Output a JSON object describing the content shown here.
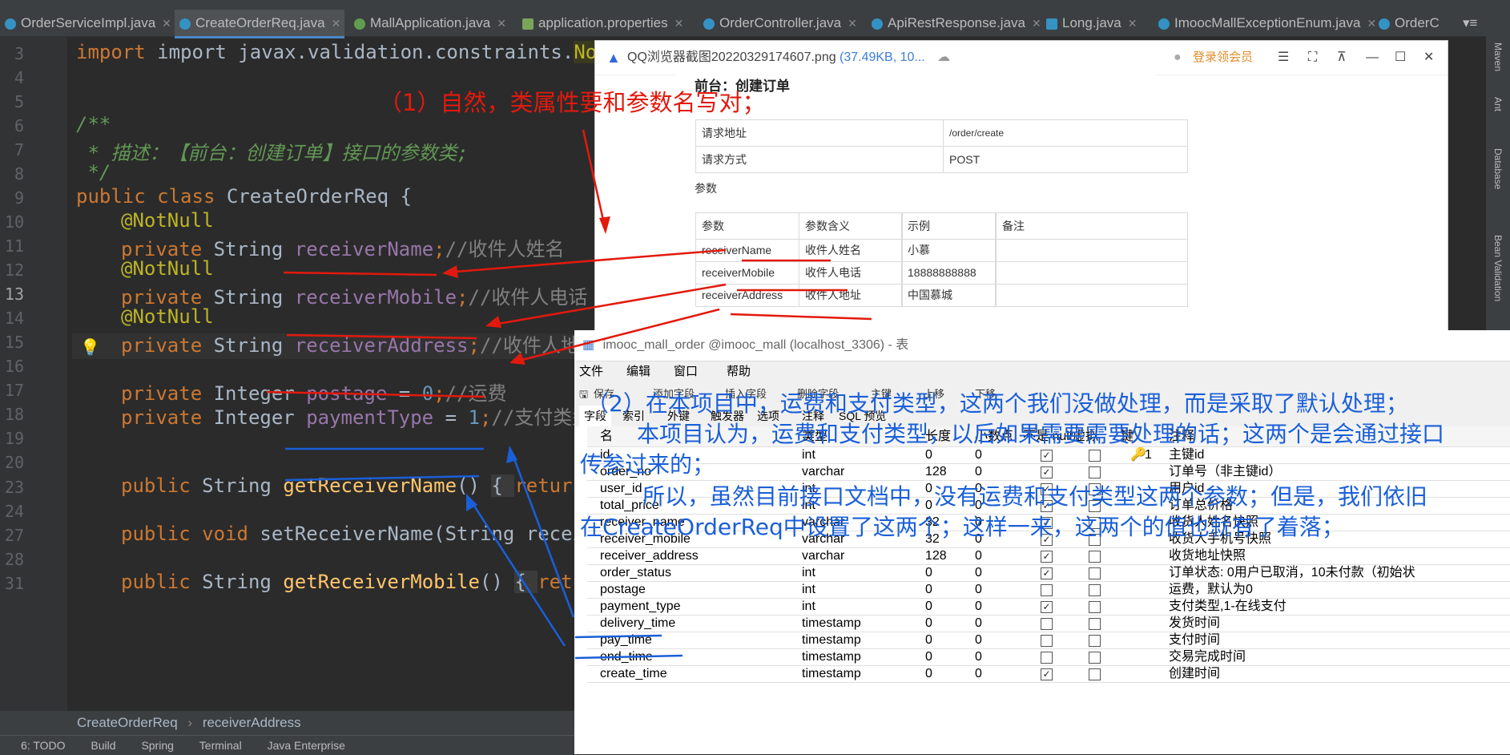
{
  "tabs": [
    {
      "label": "OrderServiceImpl.java"
    },
    {
      "label": "CreateOrderReq.java"
    },
    {
      "label": "MallApplication.java"
    },
    {
      "label": "application.properties"
    },
    {
      "label": "OrderController.java"
    },
    {
      "label": "ApiRestResponse.java"
    },
    {
      "label": "Long.java"
    },
    {
      "label": "ImoocMallExceptionEnum.java"
    },
    {
      "label": "OrderC"
    }
  ],
  "right_strip": [
    "Maven",
    "Ant",
    "Database",
    "Bean Validation"
  ],
  "editor": {
    "line_numbers": [
      "3",
      "4",
      "5",
      "6",
      "7",
      "8",
      "9",
      "10",
      "11",
      "12",
      "13",
      "14",
      "15",
      "16",
      "17",
      "18",
      "19",
      "20",
      "23",
      "24",
      "27",
      "28",
      "31"
    ],
    "lines": {
      "l3a": "import javax.validation.constraints.",
      "l3b": "NotNull",
      "l3c": ";",
      "l5": "/**",
      "l6": " * 描述：【前台：创建订单】接口的参数类;",
      "l7": " */",
      "l8a": "public class ",
      "l8b": "CreateOrderReq {",
      "ann": "@NotNull",
      "priv": "private ",
      "str": "String ",
      "int": "Integer ",
      "f1": "receiverName",
      "c1": "//收件人姓名",
      "f2": "receiverMobile",
      "c2": "//收件人电话",
      "f3": "receiverAddress",
      "c3": "//收件人地址",
      "f4": "postage",
      "v4": "0",
      "c4": "//运费",
      "f5": "paymentType",
      "v5": "1",
      "c5": "//支付类型",
      "eq": " = ",
      "semi": ";",
      "pub": "public ",
      "void": "void ",
      "m1": "getReceiverName",
      "m2": "setReceiverName",
      "m3": "getReceiverMobile",
      "paren": "() ",
      "brace": "{ ",
      "ret": "return",
      "arg": "(String recei"
    },
    "breadcrumb": [
      "CreateOrderReq",
      "receiverAddress"
    ],
    "status": [
      "6: TODO",
      "Build",
      "Spring",
      "Terminal",
      "Java Enterprise"
    ]
  },
  "viewer": {
    "title": "QQ浏览器截图20220329174607.png",
    "size": "(37.49KB",
    "size_more": ", 10...",
    "login": "登录领会员",
    "doc_title": "前台：创建订单",
    "req_url_label": "请求地址",
    "req_url": "/order/create",
    "req_method_label": "请求方式",
    "req_method": "POST",
    "params_heading": "参数",
    "param_headers": [
      "参数",
      "参数含义",
      "示例",
      "备注"
    ],
    "params": [
      {
        "name": "receiverName",
        "meaning": "收件人姓名",
        "example": "小慕"
      },
      {
        "name": "receiverMobile",
        "meaning": "收件人电话",
        "example": "18888888888"
      },
      {
        "name": "receiverAddress",
        "meaning": "收件人地址",
        "example": "中国慕城"
      }
    ]
  },
  "db": {
    "title": "imooc_mall_order @imooc_mall (localhost_3306) - 表",
    "menu": [
      "文件",
      "编辑",
      "窗口",
      "帮助"
    ],
    "toolbar": [
      "保存",
      "添加字段",
      "插入字段",
      "删除字段",
      "主键",
      "上移",
      "下移"
    ],
    "tabs": [
      "字段",
      "索引",
      "外键",
      "触发器",
      "选项",
      "注释",
      "SQL 预览"
    ],
    "headers": [
      "名",
      "类型",
      "长度",
      "小数点",
      "不是 null",
      "虚拟",
      "键",
      "注释"
    ],
    "rows": [
      {
        "name": "id",
        "type": "int",
        "len": "0",
        "dec": "0",
        "notnull": true,
        "key": "1",
        "comment": "主键id"
      },
      {
        "name": "order_no",
        "type": "varchar",
        "len": "128",
        "dec": "0",
        "notnull": true,
        "key": "",
        "comment": "订单号（非主键id）"
      },
      {
        "name": "user_id",
        "type": "int",
        "len": "0",
        "dec": "0",
        "notnull": true,
        "key": "",
        "comment": "用户id"
      },
      {
        "name": "total_price",
        "type": "int",
        "len": "0",
        "dec": "0",
        "notnull": true,
        "key": "",
        "comment": "订单总价格"
      },
      {
        "name": "receiver_name",
        "type": "varchar",
        "len": "32",
        "dec": "0",
        "notnull": true,
        "key": "",
        "comment": "收货人姓名快照"
      },
      {
        "name": "receiver_mobile",
        "type": "varchar",
        "len": "32",
        "dec": "0",
        "notnull": true,
        "key": "",
        "comment": "收货人手机号快照"
      },
      {
        "name": "receiver_address",
        "type": "varchar",
        "len": "128",
        "dec": "0",
        "notnull": true,
        "key": "",
        "comment": "收货地址快照"
      },
      {
        "name": "order_status",
        "type": "int",
        "len": "0",
        "dec": "0",
        "notnull": true,
        "key": "",
        "comment": "订单状态: 0用户已取消，10未付款（初始状"
      },
      {
        "name": "postage",
        "type": "int",
        "len": "0",
        "dec": "0",
        "notnull": false,
        "key": "",
        "comment": "运费，默认为0"
      },
      {
        "name": "payment_type",
        "type": "int",
        "len": "0",
        "dec": "0",
        "notnull": true,
        "key": "",
        "comment": "支付类型,1-在线支付"
      },
      {
        "name": "delivery_time",
        "type": "timestamp",
        "len": "0",
        "dec": "0",
        "notnull": false,
        "key": "",
        "comment": "发货时间"
      },
      {
        "name": "pay_time",
        "type": "timestamp",
        "len": "0",
        "dec": "0",
        "notnull": false,
        "key": "",
        "comment": "支付时间"
      },
      {
        "name": "end_time",
        "type": "timestamp",
        "len": "0",
        "dec": "0",
        "notnull": false,
        "key": "",
        "comment": "交易完成时间"
      },
      {
        "name": "create_time",
        "type": "timestamp",
        "len": "0",
        "dec": "0",
        "notnull": true,
        "key": "",
        "comment": "创建时间"
      }
    ]
  },
  "notes": {
    "red": "（1）自然，类属性要和参数名写对；",
    "blue1": "（2）在本项目中，运费和支付类型，这两个我们没做处理，而是采取了默认处理；",
    "blue2": "本项目认为，运费和支付类型，以后如果需要需要处理的话；这两个是会通过接口",
    "blue3": "传参过来的；",
    "blue4": "所以，虽然目前接口文档中，没有运费和支付类型这两个参数；但是，我们依旧",
    "blue5": "在CreateOrderReq中设置了这两个；这样一来，这两个的值也就有了着落；"
  },
  "colors": {
    "annotation_red": "#e3190d",
    "annotation_blue": "#1a5fd8"
  }
}
